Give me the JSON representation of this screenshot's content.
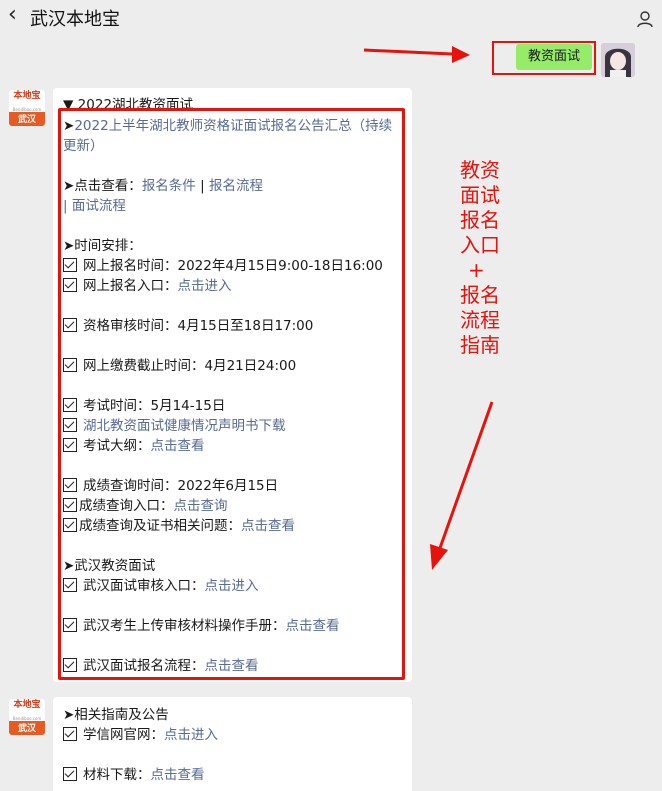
{
  "header": {
    "back_icon": "chevron-left-icon",
    "title": "武汉本地宝",
    "profile_icon": "person-icon"
  },
  "message_user": {
    "text": "教资面试"
  },
  "bot_logo": {
    "top": "本地宝",
    "sub": "Bendibao.com",
    "bottom": "武汉"
  },
  "card1": {
    "header": "▼ 2022湖北教资面试",
    "lines": [
      {
        "prefix": "➤",
        "link": "2022上半年湖北教师资格证面试报名公告汇总（持续"
      },
      {
        "link": "更新）"
      },
      {
        "prefix": "➤点击查看：",
        "link_a": "报名条件",
        "sep": " | ",
        "link_b": "报名流程"
      },
      {
        "prefix": "| ",
        "link": "面试流程"
      },
      {
        "text": "➤时间安排："
      },
      {
        "text": "网上报名时间：2022年4月15日9:00-18日16:00"
      },
      {
        "text": "网上报名入口：",
        "link": "点击进入"
      },
      {
        "text": "资格审核时间：4月15日至18日17:00"
      },
      {
        "text": "网上缴费截止时间：4月21日24:00"
      },
      {
        "text": "考试时间：5月14-15日"
      },
      {
        "link": "湖北教资面试健康情况声明书下载"
      },
      {
        "text": "考试大纲：",
        "link": "点击查看"
      },
      {
        "text": "成绩查询时间：2022年6月15日"
      },
      {
        "text": "成绩查询入口：",
        "link": "点击查询"
      },
      {
        "text": "成绩查询及证书相关问题：",
        "link": "点击查看"
      },
      {
        "text": "➤武汉教资面试"
      },
      {
        "text": "武汉面试审核入口：",
        "link": "点击进入"
      },
      {
        "text": "武汉考生上传审核材料操作手册：",
        "link": "点击查看"
      },
      {
        "text": "武汉面试报名流程：",
        "link": "点击查看"
      }
    ]
  },
  "card2": {
    "lines": [
      {
        "text": "➤相关指南及公告"
      },
      {
        "text": "学信网官网：",
        "link": "点击进入"
      },
      {
        "text": "材料下载：",
        "link": "点击查看"
      }
    ]
  },
  "annotation": {
    "lines": [
      "教资",
      "面试",
      "报名",
      "入口",
      "+",
      "报名",
      "流程",
      "指南"
    ]
  },
  "colors": {
    "link": "#576b95",
    "annotation_red": "#e8120c",
    "bubble_green": "#95ec69"
  }
}
